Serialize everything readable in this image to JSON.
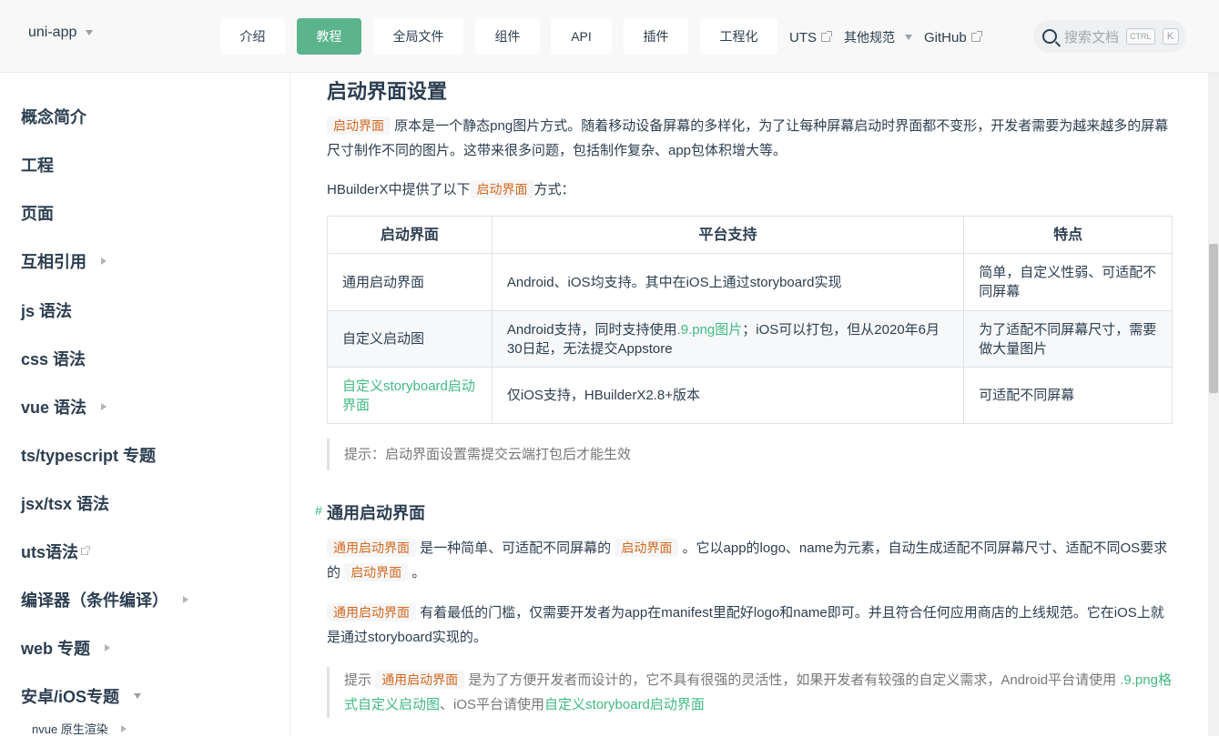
{
  "header": {
    "brand": "uni-app",
    "nav": [
      {
        "label": "介绍"
      },
      {
        "label": "教程",
        "active": true
      },
      {
        "label": "全局文件"
      },
      {
        "label": "组件"
      },
      {
        "label": "API"
      },
      {
        "label": "插件"
      },
      {
        "label": "工程化"
      }
    ],
    "links": {
      "uts": "UTS",
      "other": "其他规范",
      "github": "GitHub"
    },
    "search": {
      "placeholder": "搜索文档",
      "key1": "CTRL",
      "key2": "K"
    }
  },
  "sidebar": {
    "items": [
      {
        "label": "概念简介"
      },
      {
        "label": "工程"
      },
      {
        "label": "页面"
      },
      {
        "label": "互相引用"
      },
      {
        "label": "js 语法"
      },
      {
        "label": "css 语法"
      },
      {
        "label": "vue 语法"
      },
      {
        "label": "ts/typescript 专题"
      },
      {
        "label": "jsx/tsx 语法"
      },
      {
        "label": "uts语法"
      },
      {
        "label": "编译器（条件编译）"
      },
      {
        "label": "web 专题"
      },
      {
        "label": "安卓/iOS专题"
      }
    ],
    "sub_item": "nvue 原生渲染"
  },
  "content": {
    "section_title": "启动界面设置",
    "p1": {
      "code": "启动界面",
      "text": "原本是一个静态png图片方式。随着移动设备屏幕的多样化，为了让每种屏幕启动时界面都不变形，开发者需要为越来越多的屏幕尺寸制作不同的图片。这带来很多问题，包括制作复杂、app包体积增大等。"
    },
    "p2": {
      "pre": "HBuilderX中提供了以下",
      "code": "启动界面",
      "post": "方式："
    },
    "table": {
      "headers": [
        "启动界面",
        "平台支持",
        "特点"
      ],
      "rows": [
        {
          "c1": "通用启动界面",
          "c2": "Android、iOS均支持。其中在iOS上通过storyboard实现",
          "c3": "简单，自定义性弱、可适配不同屏幕"
        },
        {
          "c1": "自定义启动图",
          "c2_pre": "Android支持，同时支持使用",
          "c2_link": ".9.png图片",
          "c2_post": "；iOS可以打包，但从2020年6月30日起，无法提交Appstore",
          "c3": "为了适配不同屏幕尺寸，需要做大量图片"
        },
        {
          "c1_link": "自定义storyboard启动界面",
          "c2": "仅iOS支持，HBuilderX2.8+版本",
          "c3": "可适配不同屏幕"
        }
      ]
    },
    "tip1": "提示：启动界面设置需提交云端打包后才能生效",
    "section2": {
      "hash": "#",
      "title": "通用启动界面"
    },
    "p3": {
      "code1": "通用启动界面",
      "mid1": "是一种简单、可适配不同屏幕的",
      "code2": "启动界面",
      "mid2": "。它以app的logo、name为元素，自动生成适配不同屏幕尺寸、适配不同OS要求的",
      "code3": "启动界面",
      "end": "。"
    },
    "p4": {
      "code": "通用启动界面",
      "text": "有着最低的门槛，仅需要开发者为app在manifest里配好logo和name即可。并且符合任何应用商店的上线规范。它在iOS上就是通过storyboard实现的。"
    },
    "tip2": {
      "pre": "提示",
      "code": "通用启动界面",
      "mid": "是为了方便开发者而设计的，它不具有很强的灵活性，如果开发者有较强的自定义需求，Android平台请使用",
      "link1": ".9.png格式自定义启动图",
      "mid2": "、iOS平台请使用",
      "link2": "自定义storyboard启动界面"
    }
  }
}
